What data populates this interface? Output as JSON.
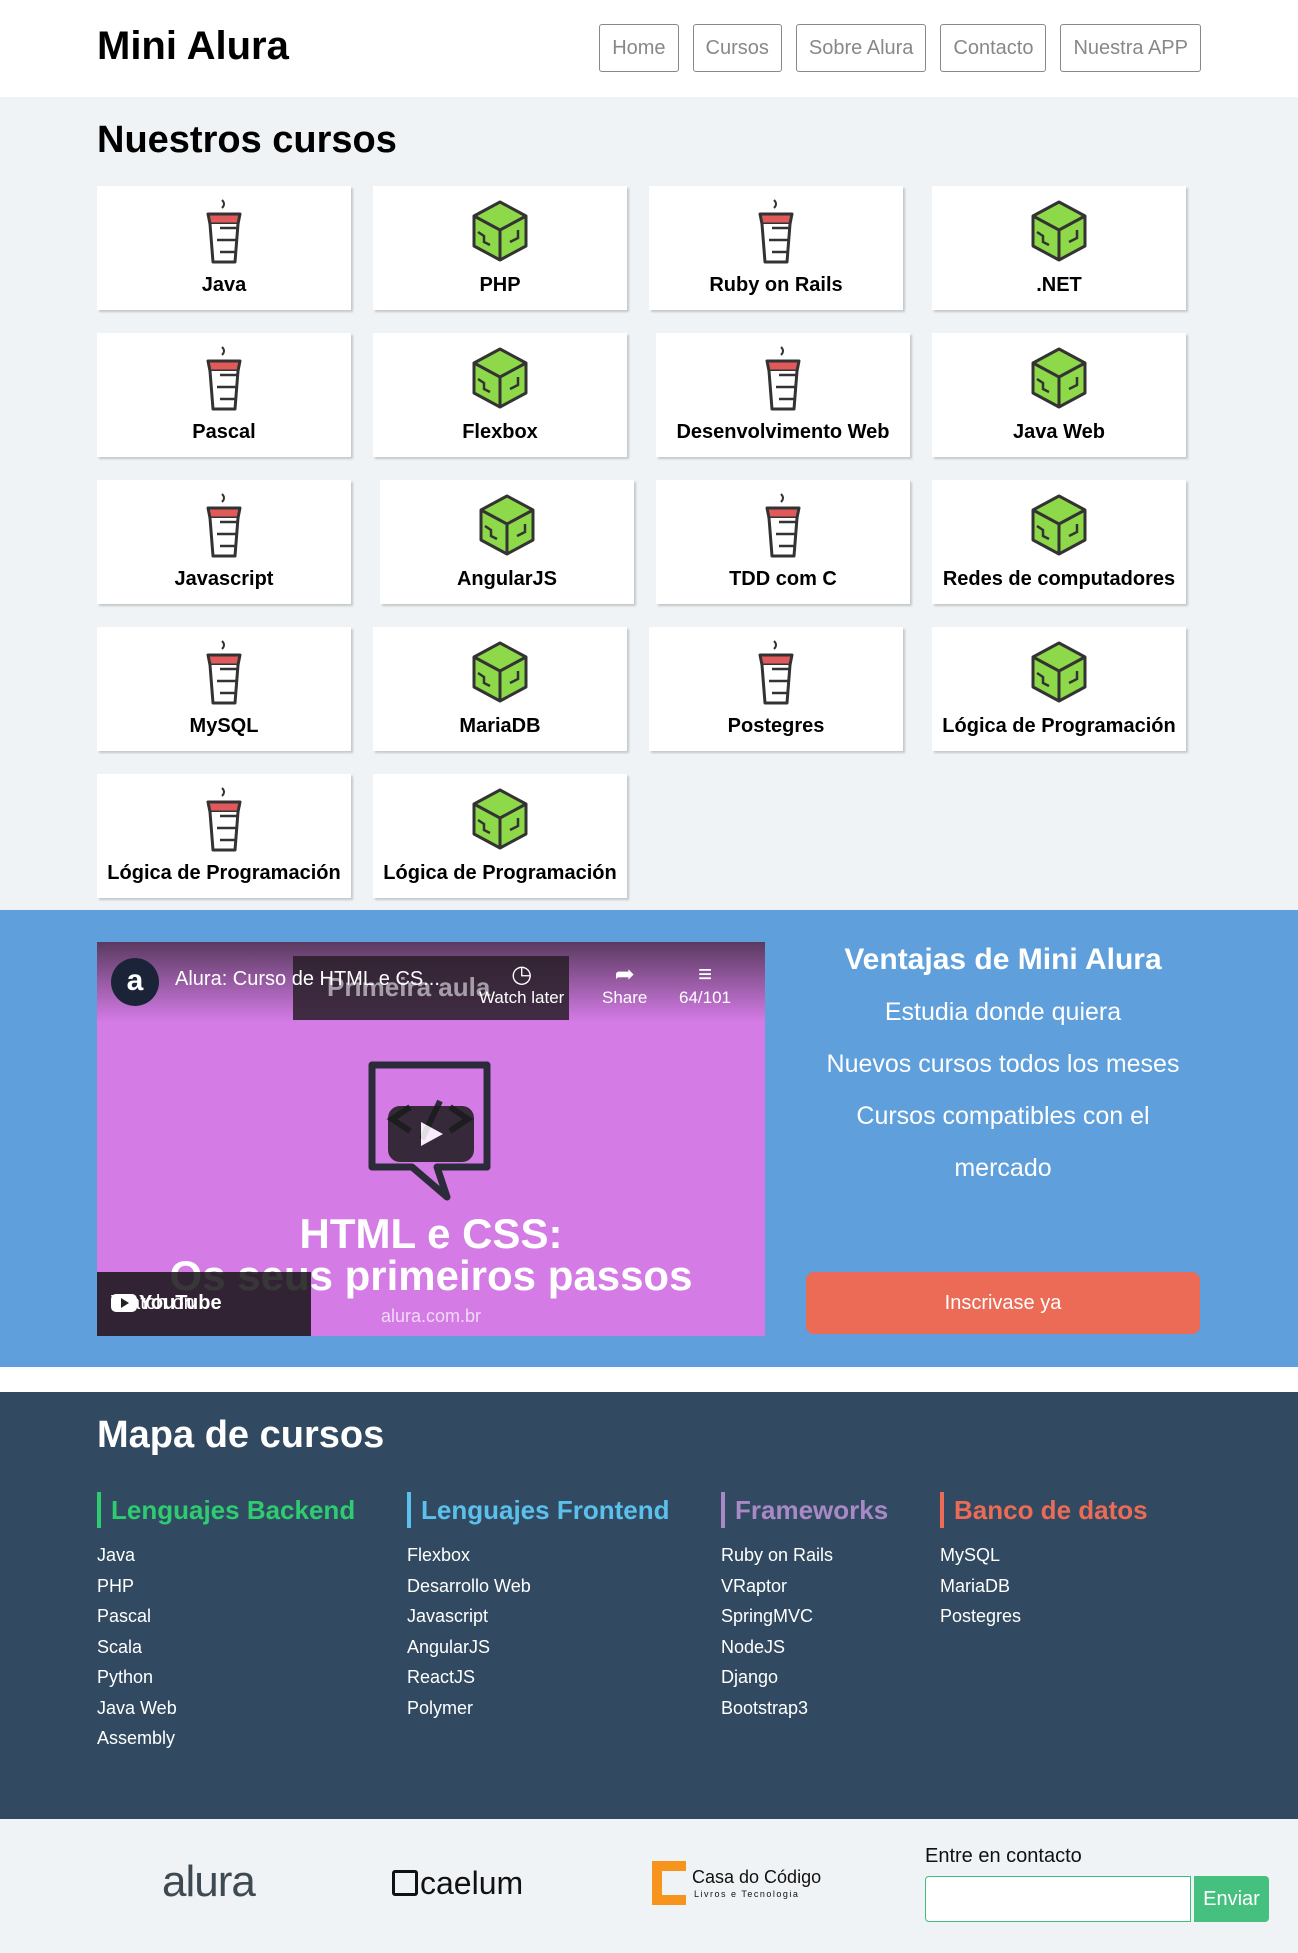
{
  "header": {
    "logo": "Mini Alura",
    "nav": [
      "Home",
      "Cursos",
      "Sobre Alura",
      "Contacto",
      "Nuestra APP"
    ]
  },
  "courses": {
    "title": "Nuestros cursos",
    "items": [
      {
        "name": "Java",
        "icon": "coffee-cup-icon"
      },
      {
        "name": "PHP",
        "icon": "green-cube-icon"
      },
      {
        "name": "Ruby on Rails",
        "icon": "coffee-cup-icon"
      },
      {
        "name": ".NET",
        "icon": "green-cube-icon"
      },
      {
        "name": "Pascal",
        "icon": "coffee-cup-icon"
      },
      {
        "name": "Flexbox",
        "icon": "green-cube-icon"
      },
      {
        "name": "Desenvolvimento Web",
        "icon": "coffee-cup-icon"
      },
      {
        "name": "Java Web",
        "icon": "green-cube-icon"
      },
      {
        "name": "Javascript",
        "icon": "coffee-cup-icon"
      },
      {
        "name": "AngularJS",
        "icon": "green-cube-icon"
      },
      {
        "name": "TDD com C",
        "icon": "coffee-cup-icon"
      },
      {
        "name": "Redes de computadores",
        "icon": "green-cube-icon"
      },
      {
        "name": "MySQL",
        "icon": "coffee-cup-icon"
      },
      {
        "name": "MariaDB",
        "icon": "green-cube-icon"
      },
      {
        "name": "Postegres",
        "icon": "coffee-cup-icon"
      },
      {
        "name": "Lógica de Programación",
        "icon": "green-cube-icon"
      },
      {
        "name": "Lógica de Programación",
        "icon": "coffee-cup-icon"
      },
      {
        "name": "Lógica de Programación",
        "icon": "green-cube-icon"
      }
    ]
  },
  "video": {
    "channel_letter": "a",
    "title": "Alura: Curso de HTML e CS...",
    "overlay_text": "Primeira aula",
    "watch_later": "Watch later",
    "share": "Share",
    "playlist": "64/101",
    "headline1": "HTML e CSS:",
    "headline2": "Os seus primeiros passos",
    "url": "alura.com.br",
    "watch_on": "Watch on",
    "youtube": "YouTube"
  },
  "advantages": {
    "title": "Ventajas de Mini Alura",
    "items": [
      "Estudia donde quiera",
      "Nuevos cursos todos los meses",
      "Cursos compatibles con el",
      "mercado"
    ],
    "cta": "Inscrivase ya"
  },
  "map": {
    "title": "Mapa de cursos",
    "columns": [
      {
        "title": "Lenguajes Backend",
        "color": "#2ecc71",
        "items": [
          "Java",
          "PHP",
          "Pascal",
          "Scala",
          "Python",
          "Java Web",
          "Assembly"
        ]
      },
      {
        "title": "Lenguajes Frontend",
        "color": "#5bc0eb",
        "items": [
          "Flexbox",
          "Desarrollo Web",
          "Javascript",
          "AngularJS",
          "ReactJS",
          "Polymer"
        ]
      },
      {
        "title": "Frameworks",
        "color": "#a989c5",
        "items": [
          "Ruby on Rails",
          "VRaptor",
          "SpringMVC",
          "NodeJS",
          "Django",
          "Bootstrap3"
        ]
      },
      {
        "title": "Banco de datos",
        "color": "#eb6b56",
        "items": [
          "MySQL",
          "MariaDB",
          "Postegres"
        ]
      }
    ]
  },
  "footer": {
    "brand1": "alura",
    "brand2": "caelum",
    "brand3_title": "Casa do Código",
    "brand3_sub": "Livros e Tecnologia",
    "contact_label": "Entre en contacto",
    "send": "Enviar",
    "email_value": ""
  },
  "colors": {
    "blue_section": "#5e9fdc",
    "map_bg": "#314a61",
    "cta": "#eb6b56",
    "send": "#46c07f"
  }
}
